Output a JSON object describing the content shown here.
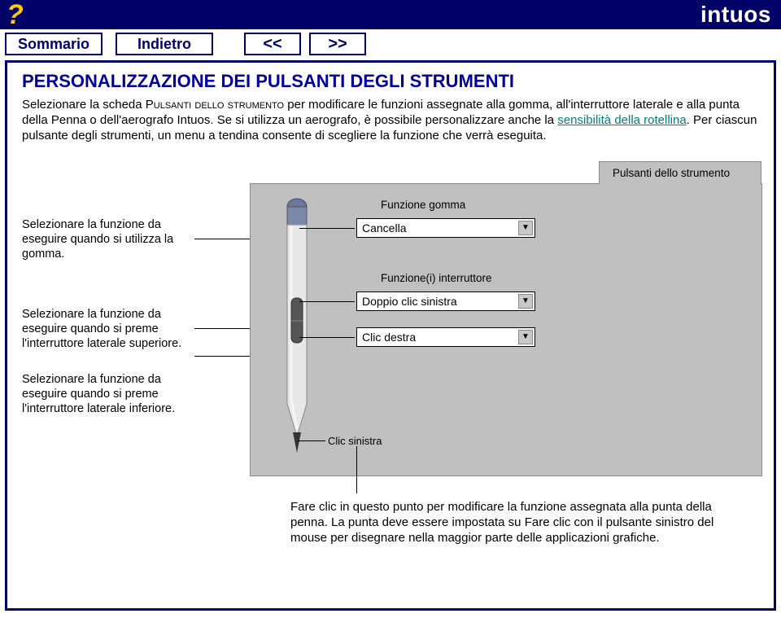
{
  "header": {
    "help_glyph": "?",
    "brand": "intuos"
  },
  "nav": {
    "sommario": "Sommario",
    "indietro": "Indietro",
    "prev": "<<",
    "next": ">>"
  },
  "page": {
    "title": "PERSONALIZZAZIONE DEI PULSANTI DEGLI STRUMENTI",
    "intro_1": "Selezionare la scheda ",
    "intro_sc": "Pulsanti dello strumento",
    "intro_2": " per modificare le funzioni assegnate alla gomma, all'interruttore laterale e alla punta della Penna o dell'aerografo Intuos. Se si utilizza un aerografo, è possibile personalizzare anche la ",
    "link": "sensibilità della rotellina",
    "intro_3": ". Per ciascun pulsante degli strumenti, un menu a tendina consente di scegliere la funzione che verrà eseguita."
  },
  "annotations": {
    "a1": "Selezionare la funzione da eseguire quando si utilizza la gomma.",
    "a2": "Selezionare la funzione da eseguire quando si preme l'interruttore laterale superiore.",
    "a3": "Selezionare la funzione da eseguire quando si preme l'interruttore laterale inferiore.",
    "bottom": "Fare clic in questo punto per modificare la funzione assegnata alla punta della penna. La punta deve essere impostata su Fare clic con il pulsante sinistro del mouse per disegnare nella maggior parte delle applicazioni grafiche."
  },
  "panel": {
    "tab": "Pulsanti dello strumento",
    "label_gomma": "Funzione gomma",
    "dd_gomma": "Cancella",
    "label_int": "Funzione(i) interruttore",
    "dd_upper": "Doppio clic sinistra",
    "dd_lower": "Clic destra",
    "tip_label": "Clic sinistra"
  }
}
